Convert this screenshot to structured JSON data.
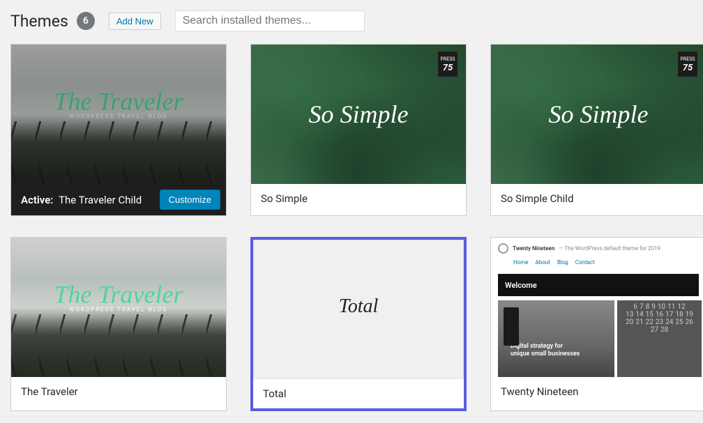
{
  "header": {
    "title": "Themes",
    "count": "6",
    "add_new_label": "Add New",
    "search_placeholder": "Search installed themes..."
  },
  "active_card": {
    "active_prefix": "Active:",
    "active_name": "The Traveler Child",
    "customize_label": "Customize",
    "preview_title": "The Traveler",
    "preview_subtitle": "WORDPRESS TRAVEL BLOG"
  },
  "press75_badge": {
    "top": "PRESS",
    "num": "75"
  },
  "themes": [
    {
      "name": "So Simple",
      "preview_text": "So Simple"
    },
    {
      "name": "So Simple Child",
      "preview_text": "So Simple"
    },
    {
      "name": "The Traveler",
      "preview_title": "The Traveler",
      "preview_subtitle": "WORDPRESS TRAVEL BLOG"
    },
    {
      "name": "Total",
      "preview_text": "Total"
    },
    {
      "name": "Twenty Nineteen"
    }
  ],
  "twentynineteen": {
    "site_name": "Twenty Nineteen",
    "tagline": "— The WordPress default theme for 2019",
    "nav": [
      "Home",
      "About",
      "Blog",
      "Contact"
    ],
    "welcome": "Welcome",
    "copy1": "Digital strategy for",
    "copy2": "unique small businesses",
    "cal": [
      [
        "6",
        "7",
        "8",
        "9",
        "10",
        "11",
        "12"
      ],
      [
        "13",
        "14",
        "15",
        "16",
        "17",
        "18",
        "19"
      ],
      [
        "20",
        "21",
        "22",
        "23",
        "24",
        "25",
        "26"
      ],
      [
        "27",
        "28",
        "",
        "",
        "",
        "",
        ""
      ]
    ]
  }
}
